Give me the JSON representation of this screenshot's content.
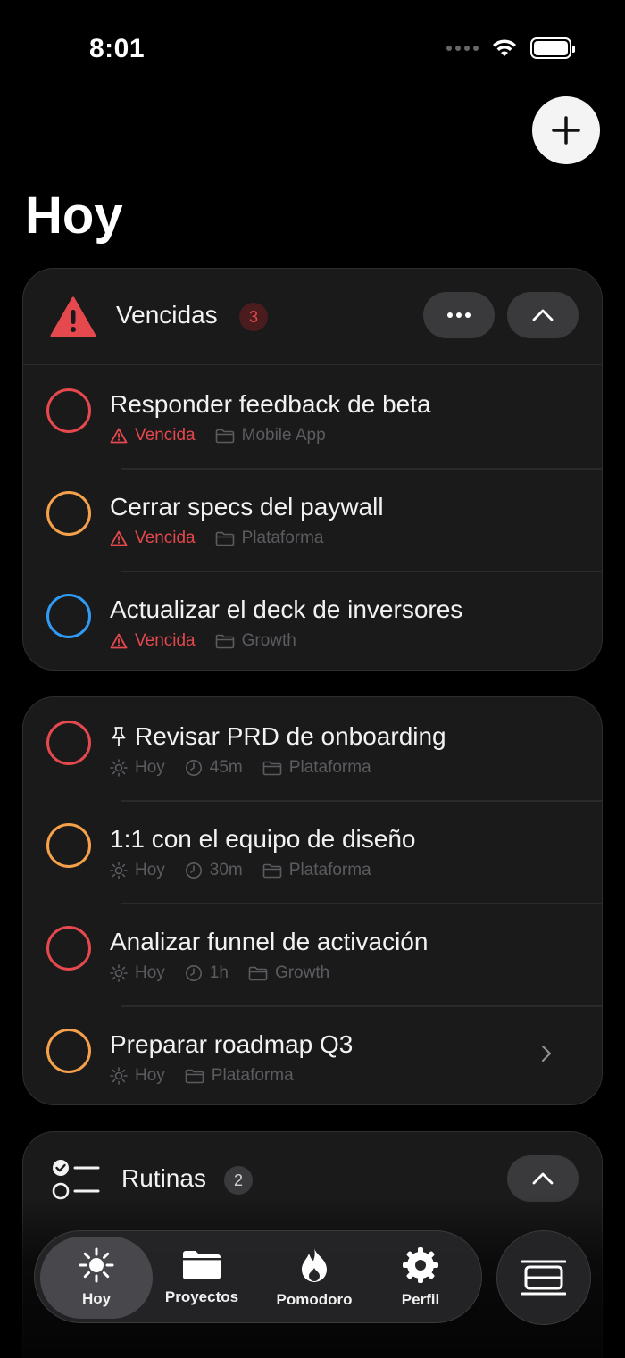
{
  "status_bar": {
    "time": "8:01"
  },
  "page": {
    "title": "Hoy"
  },
  "overdue": {
    "title": "Vencidas",
    "count": "3",
    "tasks": [
      {
        "title": "Responder feedback de beta",
        "status": "Vencida",
        "project": "Mobile App",
        "color": "#e5484d"
      },
      {
        "title": "Cerrar specs del paywall",
        "status": "Vencida",
        "project": "Plataforma",
        "color": "#f5a04a"
      },
      {
        "title": "Actualizar el deck de inversores",
        "status": "Vencida",
        "project": "Growth",
        "color": "#2f9bf5"
      }
    ]
  },
  "today": {
    "tasks": [
      {
        "title": "Revisar PRD de onboarding",
        "pinned": true,
        "day": "Hoy",
        "duration": "45m",
        "project": "Plataforma",
        "color": "#e5484d"
      },
      {
        "title": "1:1 con el equipo de diseño",
        "day": "Hoy",
        "duration": "30m",
        "project": "Plataforma",
        "color": "#f5a04a"
      },
      {
        "title": "Analizar funnel de activación",
        "day": "Hoy",
        "duration": "1h",
        "project": "Growth",
        "color": "#e5484d"
      },
      {
        "title": "Preparar roadmap Q3",
        "day": "Hoy",
        "project": "Plataforma",
        "color": "#f5a04a"
      }
    ]
  },
  "routines": {
    "title": "Rutinas",
    "count": "2"
  },
  "tabbar": {
    "tabs": [
      {
        "label": "Hoy",
        "icon": "sun-icon",
        "active": true
      },
      {
        "label": "Proyectos",
        "icon": "folder-icon"
      },
      {
        "label": "Pomodoro",
        "icon": "flame-icon"
      },
      {
        "label": "Perfil",
        "icon": "gear-icon"
      }
    ],
    "side_icon": "list-layout-icon"
  },
  "colors": {
    "overdue_red": "#e5484d",
    "orange": "#f5a04a",
    "blue": "#2f9bf5",
    "card_bg": "#1a1a1b"
  }
}
